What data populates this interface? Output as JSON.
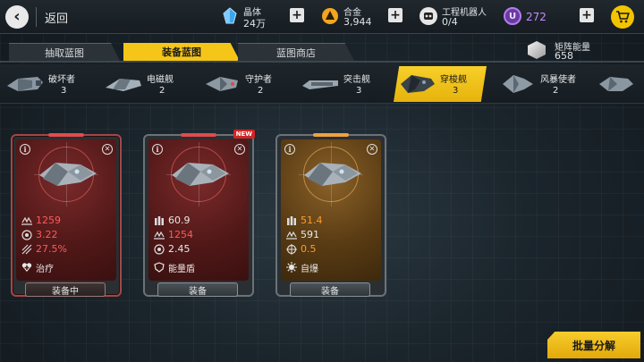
{
  "header": {
    "back_label": "返回",
    "resources": [
      {
        "name": "晶体",
        "value": "24万",
        "icon": "crystal-icon",
        "color": "#4fb6ff"
      },
      {
        "name": "合金",
        "value": "3,944",
        "icon": "alloy-icon",
        "color": "#f5a623"
      },
      {
        "name": "工程机器人",
        "value": "0/4",
        "icon": "robot-icon",
        "color": "#e0e0e0"
      }
    ],
    "u_currency": {
      "icon_letter": "U",
      "value": "272",
      "color": "#c58bff"
    }
  },
  "tabs": [
    {
      "label": "抽取蓝图",
      "active": false
    },
    {
      "label": "装备蓝图",
      "active": true
    },
    {
      "label": "蓝图商店",
      "active": false
    }
  ],
  "matrix": {
    "name": "矩阵能量",
    "value": "658"
  },
  "categories": [
    {
      "name": "破坏者",
      "count": "3",
      "active": false
    },
    {
      "name": "电磁舰",
      "count": "2",
      "active": false
    },
    {
      "name": "守护者",
      "count": "2",
      "active": false
    },
    {
      "name": "突击舰",
      "count": "3",
      "active": false
    },
    {
      "name": "穿梭舰",
      "count": "3",
      "active": true
    },
    {
      "name": "风暴使者",
      "count": "2",
      "active": false
    }
  ],
  "cards": [
    {
      "theme": "red",
      "selected": true,
      "new": false,
      "stats": [
        {
          "icon": "speed-icon",
          "value": "1259",
          "color": "red"
        },
        {
          "icon": "rate-icon",
          "value": "3.22",
          "color": "red"
        },
        {
          "icon": "crit-icon",
          "value": "27.5%",
          "color": "red"
        }
      ],
      "skill": {
        "icon": "heal-icon",
        "label": "治疗"
      },
      "button": "装备中"
    },
    {
      "theme": "red",
      "selected": false,
      "new": true,
      "new_label": "NEW",
      "stats": [
        {
          "icon": "ammo-icon",
          "value": "60.9",
          "color": "white"
        },
        {
          "icon": "speed-icon",
          "value": "1254",
          "color": "red"
        },
        {
          "icon": "rate-icon",
          "value": "2.45",
          "color": "white"
        }
      ],
      "skill": {
        "icon": "shield-icon",
        "label": "能量盾"
      },
      "button": "装备"
    },
    {
      "theme": "gold",
      "selected": false,
      "new": false,
      "stats": [
        {
          "icon": "ammo-icon",
          "value": "51.4",
          "color": "orange"
        },
        {
          "icon": "speed-icon",
          "value": "591",
          "color": "white"
        },
        {
          "icon": "target-icon",
          "value": "0.5",
          "color": "orange"
        }
      ],
      "skill": {
        "icon": "explode-icon",
        "label": "自爆"
      },
      "button": "装备"
    }
  ],
  "batch_button": "批量分解"
}
